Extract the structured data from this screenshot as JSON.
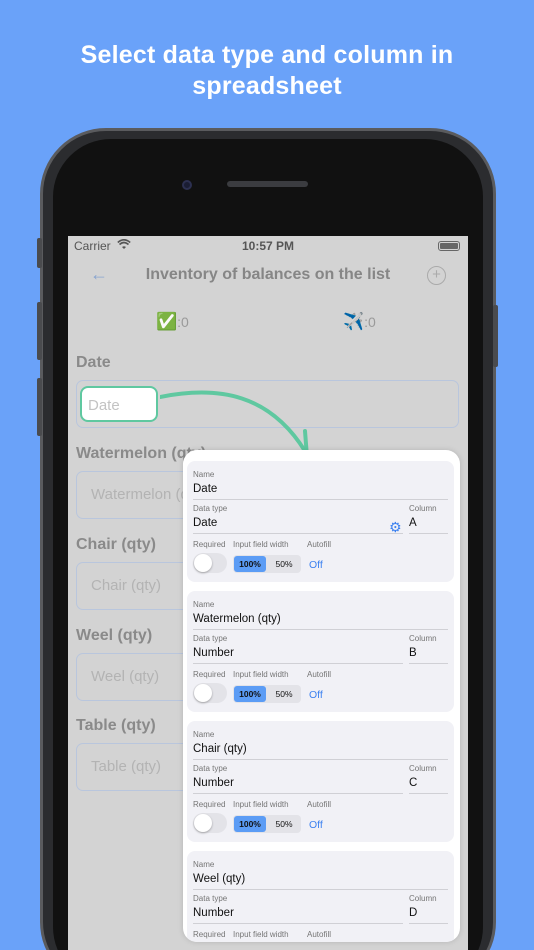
{
  "headline": {
    "line1": "Select data type and column in",
    "line2": "spreadsheet"
  },
  "status": {
    "carrier": "Carrier",
    "time": "10:57 PM"
  },
  "nav": {
    "title": "Inventory of balances on the list",
    "back_glyph": "←",
    "add_glyph": "+"
  },
  "counters": {
    "done_emoji": "✅",
    "done": ":0",
    "sent_emoji": "✈️",
    "sent": ":0"
  },
  "form": {
    "fields": [
      {
        "label": "Date",
        "placeholder": "Date"
      },
      {
        "label": "Watermelon (qty)",
        "placeholder": "Watermelon (qty)"
      },
      {
        "label": "Chair (qty)",
        "placeholder": "Chair (qty)"
      },
      {
        "label": "Weel (qty)",
        "placeholder": "Weel (qty)"
      },
      {
        "label": "Table (qty)",
        "placeholder": "Table (qty)"
      }
    ]
  },
  "settings": {
    "labels": {
      "name": "Name",
      "data_type": "Data type",
      "column": "Column",
      "required": "Required",
      "width": "Input field width",
      "autofill": "Autofill"
    },
    "width_options": [
      "100%",
      "50%"
    ],
    "autofill_value": "Off",
    "cards": [
      {
        "name": "Date",
        "data_type": "Date",
        "column": "A"
      },
      {
        "name": "Watermelon (qty)",
        "data_type": "Number",
        "column": "B"
      },
      {
        "name": "Chair (qty)",
        "data_type": "Number",
        "column": "C"
      },
      {
        "name": "Weel (qty)",
        "data_type": "Number",
        "column": "D"
      }
    ]
  },
  "colors": {
    "background": "#6aa2f9",
    "accent": "#3d82f0",
    "arrow": "#5fc8a0"
  }
}
